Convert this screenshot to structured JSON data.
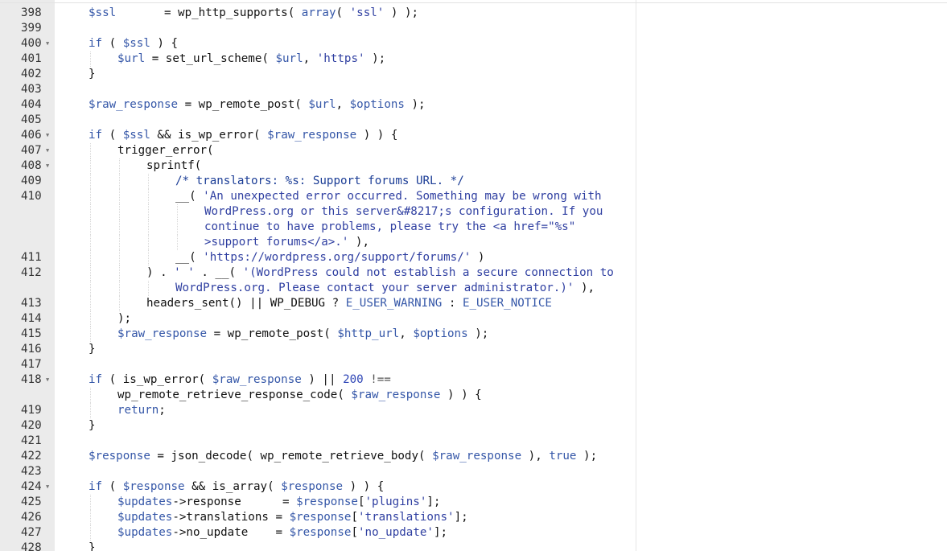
{
  "editor": {
    "lines": [
      {
        "num": "398",
        "fold": false,
        "indent": 0,
        "tokens": [
          {
            "t": "$ssl",
            "c": "var"
          },
          {
            "t": "       = wp_http_supports( ",
            "c": ""
          },
          {
            "t": "array",
            "c": "kw"
          },
          {
            "t": "( ",
            "c": ""
          },
          {
            "t": "'ssl'",
            "c": "str"
          },
          {
            "t": " ) );",
            "c": ""
          }
        ]
      },
      {
        "num": "399",
        "fold": false,
        "indent": 0,
        "tokens": []
      },
      {
        "num": "400",
        "fold": true,
        "indent": 0,
        "tokens": [
          {
            "t": "if",
            "c": "kw"
          },
          {
            "t": " ( ",
            "c": ""
          },
          {
            "t": "$ssl",
            "c": "var"
          },
          {
            "t": " ) {",
            "c": ""
          }
        ]
      },
      {
        "num": "401",
        "fold": false,
        "indent": 1,
        "tokens": [
          {
            "t": "$url",
            "c": "var"
          },
          {
            "t": " = set_url_scheme( ",
            "c": ""
          },
          {
            "t": "$url",
            "c": "var"
          },
          {
            "t": ", ",
            "c": ""
          },
          {
            "t": "'https'",
            "c": "str"
          },
          {
            "t": " );",
            "c": ""
          }
        ]
      },
      {
        "num": "402",
        "fold": false,
        "indent": 0,
        "tokens": [
          {
            "t": "}",
            "c": ""
          }
        ]
      },
      {
        "num": "403",
        "fold": false,
        "indent": 0,
        "tokens": []
      },
      {
        "num": "404",
        "fold": false,
        "indent": 0,
        "tokens": [
          {
            "t": "$raw_response",
            "c": "var"
          },
          {
            "t": " = wp_remote_post( ",
            "c": ""
          },
          {
            "t": "$url",
            "c": "var"
          },
          {
            "t": ", ",
            "c": ""
          },
          {
            "t": "$options",
            "c": "var"
          },
          {
            "t": " );",
            "c": ""
          }
        ]
      },
      {
        "num": "405",
        "fold": false,
        "indent": 0,
        "tokens": []
      },
      {
        "num": "406",
        "fold": true,
        "indent": 0,
        "tokens": [
          {
            "t": "if",
            "c": "kw"
          },
          {
            "t": " ( ",
            "c": ""
          },
          {
            "t": "$ssl",
            "c": "var"
          },
          {
            "t": " && is_wp_error( ",
            "c": ""
          },
          {
            "t": "$raw_response",
            "c": "var"
          },
          {
            "t": " ) ) {",
            "c": ""
          }
        ]
      },
      {
        "num": "407",
        "fold": true,
        "indent": 1,
        "tokens": [
          {
            "t": "trigger_error(",
            "c": ""
          }
        ]
      },
      {
        "num": "408",
        "fold": true,
        "indent": 2,
        "tokens": [
          {
            "t": "sprintf(",
            "c": ""
          }
        ]
      },
      {
        "num": "409",
        "fold": false,
        "indent": 3,
        "tokens": [
          {
            "t": "/* translators: %s: Support forums URL. */",
            "c": "com"
          }
        ]
      },
      {
        "num": "410",
        "fold": false,
        "indent": 3,
        "tokens": [
          {
            "t": "__( ",
            "c": ""
          },
          {
            "t": "'An unexpected error occurred. Something may be wrong with",
            "c": "str"
          }
        ]
      },
      {
        "num": "",
        "fold": false,
        "indent": 4,
        "tokens": [
          {
            "t": "WordPress.org or this server&#8217;s configuration. If you",
            "c": "str"
          }
        ]
      },
      {
        "num": "",
        "fold": false,
        "indent": 4,
        "tokens": [
          {
            "t": "continue to have problems, please try the <a href=\"%s\"",
            "c": "str"
          }
        ]
      },
      {
        "num": "",
        "fold": false,
        "indent": 4,
        "tokens": [
          {
            "t": ">support forums</a>.'",
            "c": "str"
          },
          {
            "t": " ),",
            "c": ""
          }
        ]
      },
      {
        "num": "411",
        "fold": false,
        "indent": 3,
        "tokens": [
          {
            "t": "__( ",
            "c": ""
          },
          {
            "t": "'https://wordpress.org/support/forums/'",
            "c": "str"
          },
          {
            "t": " )",
            "c": ""
          }
        ]
      },
      {
        "num": "412",
        "fold": false,
        "indent": 2,
        "tokens": [
          {
            "t": ") . ",
            "c": ""
          },
          {
            "t": "' '",
            "c": "str"
          },
          {
            "t": " . __( ",
            "c": ""
          },
          {
            "t": "'(WordPress could not establish a secure connection to",
            "c": "str"
          }
        ]
      },
      {
        "num": "",
        "fold": false,
        "indent": 3,
        "tokens": [
          {
            "t": "WordPress.org. Please contact your server administrator.)'",
            "c": "str"
          },
          {
            "t": " ),",
            "c": ""
          }
        ]
      },
      {
        "num": "413",
        "fold": false,
        "indent": 2,
        "tokens": [
          {
            "t": "headers_sent() || WP_DEBUG ? ",
            "c": ""
          },
          {
            "t": "E_USER_WARNING",
            "c": "var"
          },
          {
            "t": " : ",
            "c": ""
          },
          {
            "t": "E_USER_NOTICE",
            "c": "var"
          }
        ]
      },
      {
        "num": "414",
        "fold": false,
        "indent": 1,
        "tokens": [
          {
            "t": ");",
            "c": ""
          }
        ]
      },
      {
        "num": "415",
        "fold": false,
        "indent": 1,
        "tokens": [
          {
            "t": "$raw_response",
            "c": "var"
          },
          {
            "t": " = wp_remote_post( ",
            "c": ""
          },
          {
            "t": "$http_url",
            "c": "var"
          },
          {
            "t": ", ",
            "c": ""
          },
          {
            "t": "$options",
            "c": "var"
          },
          {
            "t": " );",
            "c": ""
          }
        ]
      },
      {
        "num": "416",
        "fold": false,
        "indent": 0,
        "tokens": [
          {
            "t": "}",
            "c": ""
          }
        ]
      },
      {
        "num": "417",
        "fold": false,
        "indent": 0,
        "tokens": []
      },
      {
        "num": "418",
        "fold": true,
        "indent": 0,
        "tokens": [
          {
            "t": "if",
            "c": "kw"
          },
          {
            "t": " ( is_wp_error( ",
            "c": ""
          },
          {
            "t": "$raw_response",
            "c": "var"
          },
          {
            "t": " ) || ",
            "c": ""
          },
          {
            "t": "200",
            "c": "num"
          },
          {
            "t": " !==",
            "c": "op"
          }
        ]
      },
      {
        "num": "",
        "fold": false,
        "indent": 1,
        "tokens": [
          {
            "t": "wp_remote_retrieve_response_code( ",
            "c": ""
          },
          {
            "t": "$raw_response",
            "c": "var"
          },
          {
            "t": " ) ) {",
            "c": ""
          }
        ]
      },
      {
        "num": "419",
        "fold": false,
        "indent": 1,
        "tokens": [
          {
            "t": "return",
            "c": "kw"
          },
          {
            "t": ";",
            "c": ""
          }
        ]
      },
      {
        "num": "420",
        "fold": false,
        "indent": 0,
        "tokens": [
          {
            "t": "}",
            "c": ""
          }
        ]
      },
      {
        "num": "421",
        "fold": false,
        "indent": 0,
        "tokens": []
      },
      {
        "num": "422",
        "fold": false,
        "indent": 0,
        "tokens": [
          {
            "t": "$response",
            "c": "var"
          },
          {
            "t": " = json_decode( wp_remote_retrieve_body( ",
            "c": ""
          },
          {
            "t": "$raw_response",
            "c": "var"
          },
          {
            "t": " ), ",
            "c": ""
          },
          {
            "t": "true",
            "c": "kw"
          },
          {
            "t": " );",
            "c": ""
          }
        ]
      },
      {
        "num": "423",
        "fold": false,
        "indent": 0,
        "tokens": []
      },
      {
        "num": "424",
        "fold": true,
        "indent": 0,
        "tokens": [
          {
            "t": "if",
            "c": "kw"
          },
          {
            "t": " ( ",
            "c": ""
          },
          {
            "t": "$response",
            "c": "var"
          },
          {
            "t": " && is_array( ",
            "c": ""
          },
          {
            "t": "$response",
            "c": "var"
          },
          {
            "t": " ) ) {",
            "c": ""
          }
        ]
      },
      {
        "num": "425",
        "fold": false,
        "indent": 1,
        "tokens": [
          {
            "t": "$updates",
            "c": "var"
          },
          {
            "t": "->response      = ",
            "c": ""
          },
          {
            "t": "$response",
            "c": "var"
          },
          {
            "t": "[",
            "c": ""
          },
          {
            "t": "'plugins'",
            "c": "str"
          },
          {
            "t": "];",
            "c": ""
          }
        ]
      },
      {
        "num": "426",
        "fold": false,
        "indent": 1,
        "tokens": [
          {
            "t": "$updates",
            "c": "var"
          },
          {
            "t": "->translations = ",
            "c": ""
          },
          {
            "t": "$response",
            "c": "var"
          },
          {
            "t": "[",
            "c": ""
          },
          {
            "t": "'translations'",
            "c": "str"
          },
          {
            "t": "];",
            "c": ""
          }
        ]
      },
      {
        "num": "427",
        "fold": false,
        "indent": 1,
        "tokens": [
          {
            "t": "$updates",
            "c": "var"
          },
          {
            "t": "->no_update    = ",
            "c": ""
          },
          {
            "t": "$response",
            "c": "var"
          },
          {
            "t": "[",
            "c": ""
          },
          {
            "t": "'no_update'",
            "c": "str"
          },
          {
            "t": "];",
            "c": ""
          }
        ]
      },
      {
        "num": "428",
        "fold": false,
        "indent": 0,
        "tokens": [
          {
            "t": "}",
            "c": ""
          }
        ]
      }
    ]
  }
}
